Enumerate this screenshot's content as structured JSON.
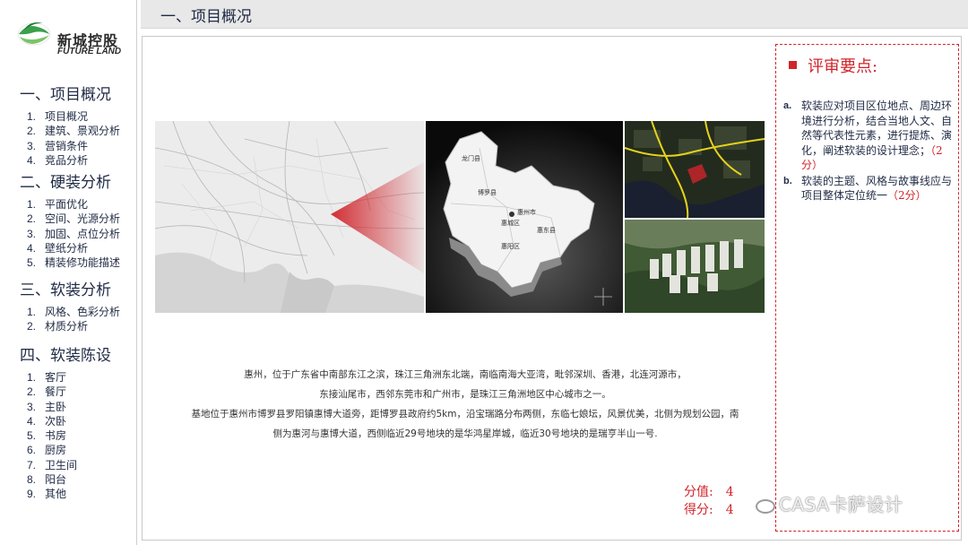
{
  "logo": {
    "name_cn": "新城控股",
    "name_en": "FUTURE LAND"
  },
  "header": {
    "title": "一、项目概况"
  },
  "sidebar": {
    "sections": [
      {
        "title": "一、项目概况",
        "items": [
          {
            "num": "1.",
            "label": "项目概况"
          },
          {
            "num": "2.",
            "label": "建筑、景观分析"
          },
          {
            "num": "3.",
            "label": "营销条件"
          },
          {
            "num": "4.",
            "label": "竞品分析"
          }
        ]
      },
      {
        "title": "二、硬装分析",
        "items": [
          {
            "num": "1.",
            "label": "平面优化"
          },
          {
            "num": "2.",
            "label": "空间、光源分析"
          },
          {
            "num": "3.",
            "label": "加固、点位分析"
          },
          {
            "num": "4.",
            "label": "壁纸分析"
          },
          {
            "num": "5.",
            "label": "精装修功能描述"
          }
        ]
      },
      {
        "title": "三、软装分析",
        "items": [
          {
            "num": "1.",
            "label": "风格、色彩分析"
          },
          {
            "num": "2.",
            "label": "材质分析"
          }
        ]
      },
      {
        "title": "四、软装陈设",
        "items": [
          {
            "num": "1.",
            "label": "客厅"
          },
          {
            "num": "2.",
            "label": "餐厅"
          },
          {
            "num": "3.",
            "label": "主卧"
          },
          {
            "num": "4.",
            "label": "次卧"
          },
          {
            "num": "5.",
            "label": "书房"
          },
          {
            "num": "6.",
            "label": "厨房"
          },
          {
            "num": "7.",
            "label": "卫生间"
          },
          {
            "num": "8.",
            "label": "阳台"
          },
          {
            "num": "9.",
            "label": "其他"
          }
        ]
      }
    ]
  },
  "region_map": {
    "labels": [
      "龙门县",
      "博罗县",
      "惠州市",
      "惠城区",
      "惠东县",
      "惠阳区"
    ]
  },
  "description": {
    "lines": [
      "惠州，位于广东省中南部东江之滨，珠江三角洲东北端，南临南海大亚湾，毗邻深圳、香港，北连河源市，",
      "东接汕尾市，西邻东莞市和广州市，是珠江三角洲地区中心城市之一。",
      "基地位于惠州市博罗县罗阳镇惠博大道旁，距博罗县政府约5km，沿宝瑞路分布两侧，东临七娘坛，风景优美，北侧为规划公园，南",
      "侧为惠河与惠博大道，西侧临近29号地块的是华鸿星岸城，临近30号地块的是瑞亨半山一号."
    ]
  },
  "score": {
    "value_label": "分值:",
    "value": "4",
    "score_label": "得分:",
    "score": "4"
  },
  "watermark": {
    "text": "CASA卡萨设计"
  },
  "review": {
    "title": "评审要点:",
    "items": [
      {
        "label": "a.",
        "text": "软装应对项目区位地点、周边环境进行分析，结合当地人文、自然等代表性元素，进行提炼、演化，阐述软装的设计理念；",
        "points": "（2分）"
      },
      {
        "label": "b.",
        "text": "软装的主题、风格与故事线应与项目整体定位统一",
        "points": "（2分）"
      }
    ]
  },
  "colors": {
    "accent": "#d0242b",
    "text": "#1f2a44",
    "header_bg": "#e8e8e8"
  }
}
